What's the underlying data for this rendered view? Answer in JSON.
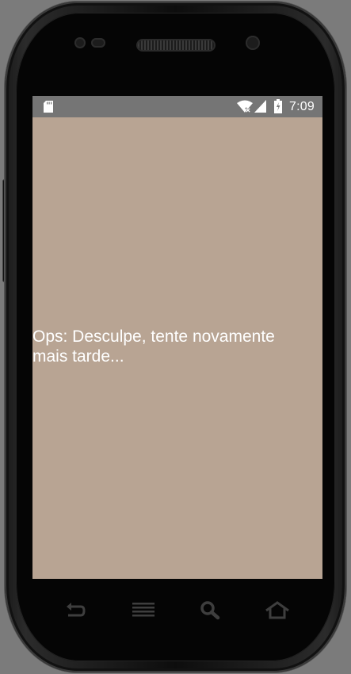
{
  "status_bar": {
    "time": "7:09",
    "icons": [
      "sd-card-icon",
      "wifi-icon",
      "cell-signal-icon",
      "battery-icon"
    ]
  },
  "screen": {
    "background_color": "#b8a493",
    "message": "Ops: Desculpe, tente novamente mais tarde..."
  },
  "hardware_buttons": [
    "back-icon",
    "menu-icon",
    "search-icon",
    "home-icon"
  ]
}
